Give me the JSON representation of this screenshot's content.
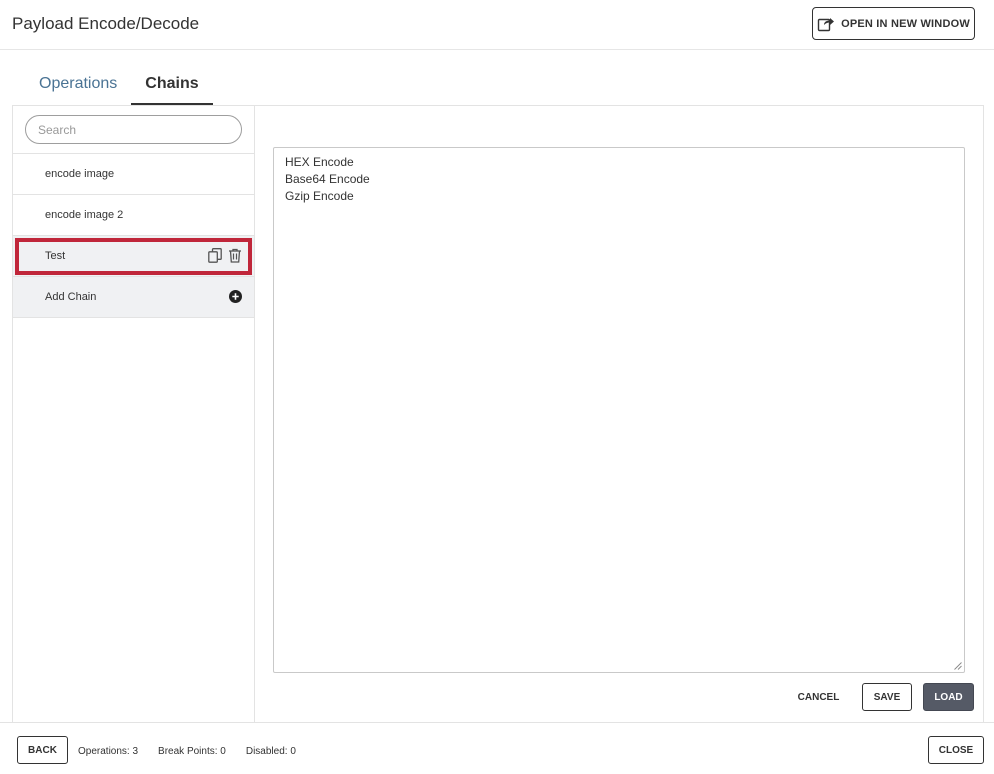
{
  "header": {
    "title": "Payload Encode/Decode",
    "open_window_label": "OPEN IN NEW WINDOW",
    "open_window_icon": "external-window-icon"
  },
  "tabs": [
    {
      "label": "Operations",
      "active": false
    },
    {
      "label": "Chains",
      "active": true
    }
  ],
  "sidebar": {
    "search_placeholder": "Search",
    "search_value": "",
    "chains": [
      {
        "label": "encode image"
      },
      {
        "label": "encode image 2"
      },
      {
        "label": "Test",
        "selected": true,
        "actions": [
          "copy-icon",
          "trash-icon"
        ]
      }
    ],
    "add_chain_label": "Add Chain",
    "add_chain_icon": "plus-circle-icon"
  },
  "editor": {
    "operations": [
      "HEX Encode",
      "Base64 Encode",
      "Gzip Encode"
    ],
    "cancel_label": "CANCEL",
    "save_label": "SAVE",
    "load_label": "LOAD"
  },
  "footer": {
    "back_label": "BACK",
    "operations_text": "Operations: 3",
    "break_points_text": "Break Points: 0",
    "disabled_text": "Disabled: 0",
    "close_label": "CLOSE"
  },
  "colors": {
    "highlight": "#c0263a",
    "inactive_tab": "#4a7394",
    "load_button": "#555a66",
    "selected_row": "#f0f1f3"
  }
}
